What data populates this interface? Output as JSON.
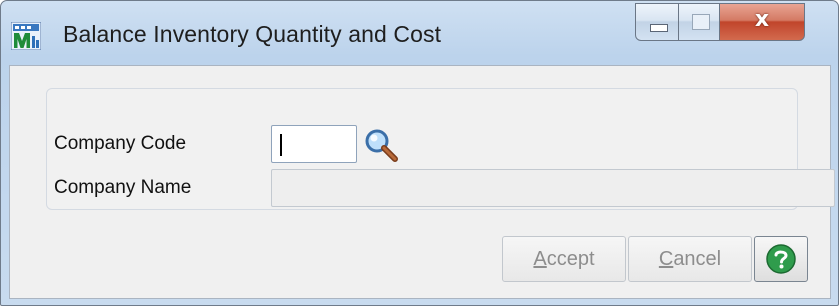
{
  "window": {
    "title": "Balance Inventory Quantity and Cost",
    "controls": {
      "minimize": "minimize",
      "maximize": "maximize",
      "close": "x"
    }
  },
  "form": {
    "company_code_label": "Company Code",
    "company_code_value": "",
    "company_name_label": "Company Name",
    "company_name_value": ""
  },
  "buttons": {
    "accept_label_key": "A",
    "accept_label_rest": "ccept",
    "cancel_label_key": "C",
    "cancel_label_rest": "ancel"
  },
  "icons": {
    "app": "sage-mas90-app-icon",
    "search": "magnifier-icon",
    "help": "help-question-icon"
  },
  "colors": {
    "close_button": "#c0452b",
    "help_icon": "#2f9c4c",
    "search_icon_lens": "#5aa0dc"
  }
}
